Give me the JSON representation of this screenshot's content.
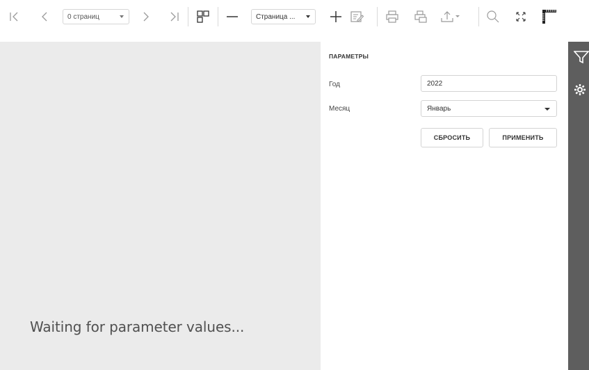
{
  "toolbar": {
    "page_count_select": "0 страниц",
    "zoom_select": "Страница ...",
    "icons": [
      "first-page-icon",
      "prev-page-icon",
      "next-page-icon",
      "last-page-icon",
      "multipage-icon",
      "zoom-out-icon",
      "zoom-in-icon",
      "edit-fields-icon",
      "print-icon",
      "print-page-icon",
      "export-icon",
      "search-icon",
      "fullscreen-icon",
      "ruler-icon"
    ]
  },
  "preview": {
    "status_text": "Waiting for parameter values..."
  },
  "parameters": {
    "title": "ПАРАМЕТРЫ",
    "fields": [
      {
        "label": "Год",
        "value": "2022"
      },
      {
        "label": "Месяц",
        "value": "Январь"
      }
    ],
    "reset_label": "СБРОСИТЬ",
    "apply_label": "ПРИМЕНИТЬ"
  },
  "rail": {
    "icons": [
      "filter-icon",
      "gear-icon"
    ]
  },
  "colors": {
    "preview_bg": "#ebebeb",
    "rail_bg": "#5e5e5e",
    "icon_gray": "#9a9a9a",
    "icon_dark": "#333333"
  }
}
